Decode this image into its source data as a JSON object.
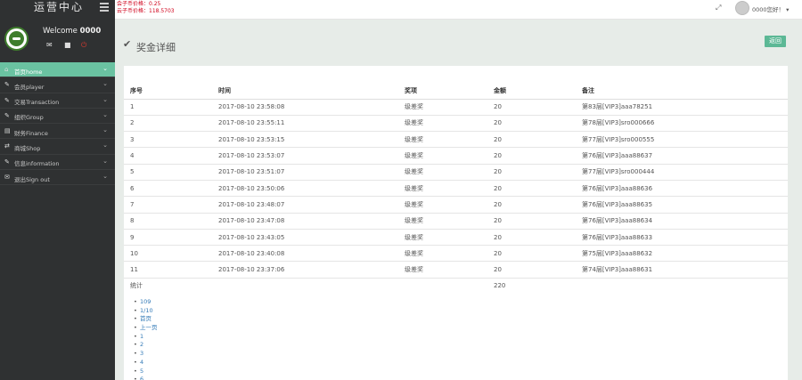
{
  "header": {
    "brand_title": "运营中心",
    "prices": [
      "会子币价格：0.25",
      "云子币价格：118.5703"
    ],
    "user_name": "0000您好！"
  },
  "sidebar": {
    "welcome_prefix": "Welcome ",
    "welcome_user": "0000",
    "nav": [
      {
        "label": "首页home",
        "icon": "home-icon",
        "glyph": "⌂",
        "active": true
      },
      {
        "label": "会员player",
        "icon": "user-icon",
        "glyph": "✎",
        "active": false
      },
      {
        "label": "交易Transaction",
        "icon": "edit-icon",
        "glyph": "✎",
        "active": false
      },
      {
        "label": "组织Group",
        "icon": "pencil-icon",
        "glyph": "✎",
        "active": false
      },
      {
        "label": "财务Finance",
        "icon": "money-icon",
        "glyph": "▤",
        "active": false
      },
      {
        "label": "商城Shop",
        "icon": "shuffle-icon",
        "glyph": "⇄",
        "active": false
      },
      {
        "label": "信息information",
        "icon": "wrench-icon",
        "glyph": "✎",
        "active": false
      },
      {
        "label": "退出Sign out",
        "icon": "envelope-icon",
        "glyph": "✉",
        "active": false
      }
    ]
  },
  "page": {
    "title": "奖金详细",
    "back_label": "返回"
  },
  "table": {
    "headers": [
      "序号",
      "时间",
      "奖项",
      "金额",
      "备注"
    ],
    "rows": [
      [
        "1",
        "2017-08-10 23:58:08",
        "级差奖",
        "20",
        "第83层[VIP3]aaa78251"
      ],
      [
        "2",
        "2017-08-10 23:55:11",
        "级差奖",
        "20",
        "第78层[VIP3]sro000666"
      ],
      [
        "3",
        "2017-08-10 23:53:15",
        "级差奖",
        "20",
        "第77层[VIP3]sro000555"
      ],
      [
        "4",
        "2017-08-10 23:53:07",
        "级差奖",
        "20",
        "第76层[VIP3]aaa88637"
      ],
      [
        "5",
        "2017-08-10 23:51:07",
        "级差奖",
        "20",
        "第77层[VIP3]sro000444"
      ],
      [
        "6",
        "2017-08-10 23:50:06",
        "级差奖",
        "20",
        "第76层[VIP3]aaa88636"
      ],
      [
        "7",
        "2017-08-10 23:48:07",
        "级差奖",
        "20",
        "第76层[VIP3]aaa88635"
      ],
      [
        "8",
        "2017-08-10 23:47:08",
        "级差奖",
        "20",
        "第76层[VIP3]aaa88634"
      ],
      [
        "9",
        "2017-08-10 23:43:05",
        "级差奖",
        "20",
        "第76层[VIP3]aaa88633"
      ],
      [
        "10",
        "2017-08-10 23:40:08",
        "级差奖",
        "20",
        "第75层[VIP3]aaa88632"
      ],
      [
        "11",
        "2017-08-10 23:37:06",
        "级差奖",
        "20",
        "第74层[VIP3]aaa88631"
      ]
    ],
    "total_label": "统计",
    "total_value": "220"
  },
  "pagination": [
    "109",
    "1/10",
    "首页",
    "上一页",
    "1",
    "2",
    "3",
    "4",
    "5",
    "6"
  ]
}
